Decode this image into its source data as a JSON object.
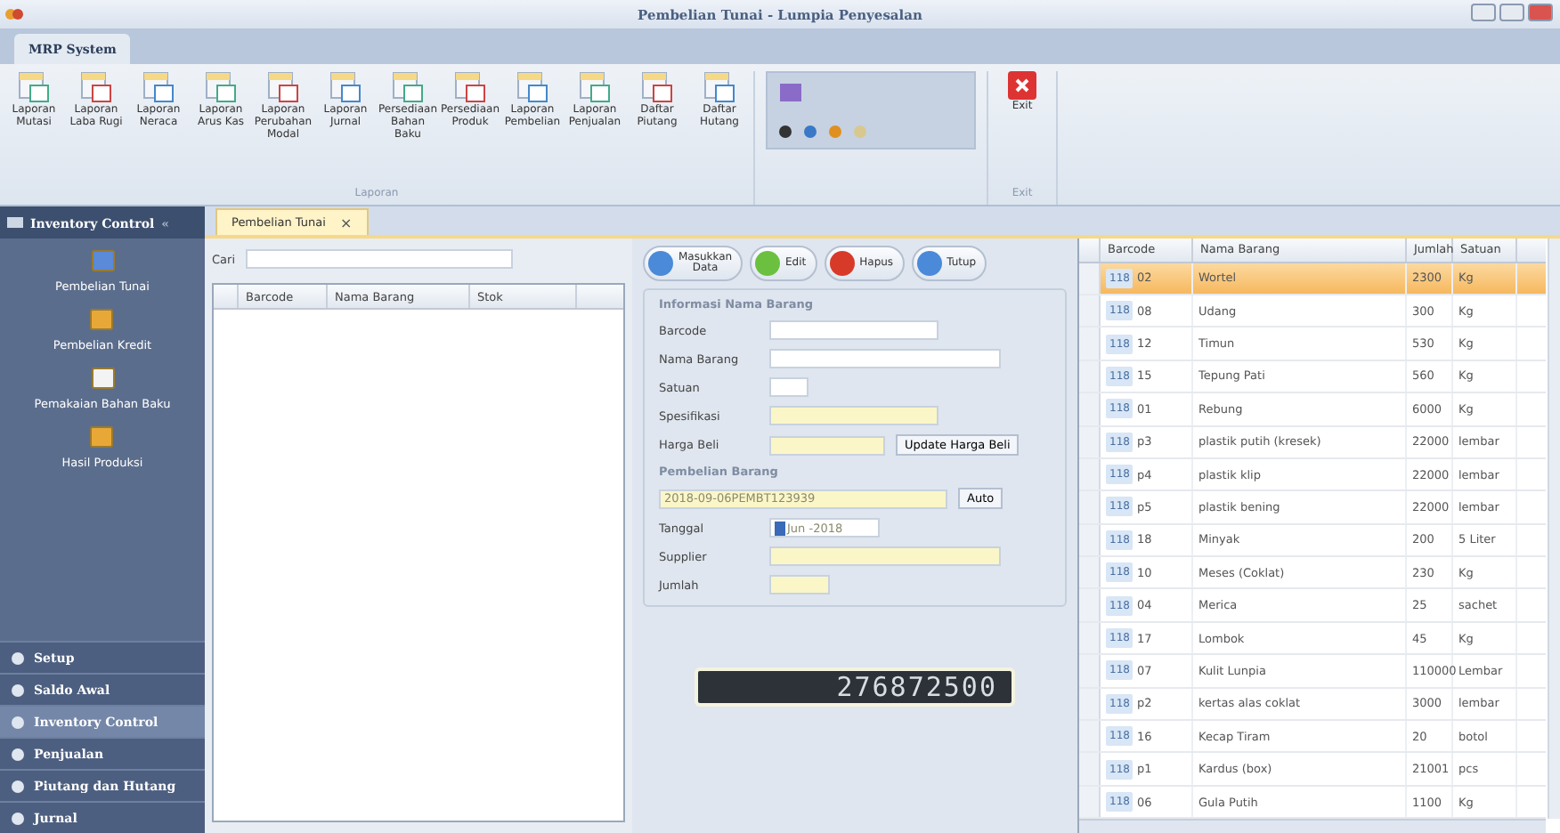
{
  "window": {
    "title": "Pembelian Tunai - Lumpia Penyesalan"
  },
  "ribbon": {
    "tabs": [
      {
        "label": "MRP System",
        "selected": true
      }
    ],
    "buttons": [
      {
        "label": "Laporan Mutasi"
      },
      {
        "label": "Laporan Laba Rugi"
      },
      {
        "label": "Laporan Neraca"
      },
      {
        "label": "Laporan Arus Kas"
      },
      {
        "label": "Laporan Perubahan Modal"
      },
      {
        "label": "Laporan Jurnal"
      },
      {
        "label": "Persediaan Bahan Baku"
      },
      {
        "label": "Persediaan Produk"
      },
      {
        "label": "Laporan Pembelian"
      },
      {
        "label": "Laporan Penjualan"
      },
      {
        "label": "Daftar Piutang"
      },
      {
        "label": "Daftar Hutang"
      }
    ],
    "group_label": "Laporan",
    "exit_label": "Exit",
    "exit_group_label": "Exit"
  },
  "sidebar": {
    "title": "Inventory Control",
    "collapse": "«",
    "items": [
      {
        "label": "Pembelian Tunai"
      },
      {
        "label": "Pembelian Kredit"
      },
      {
        "label": "Pemakaian Bahan Baku"
      },
      {
        "label": "Hasil Produksi"
      }
    ],
    "nav": [
      {
        "label": "Setup",
        "selected": false
      },
      {
        "label": "Saldo Awal",
        "selected": false
      },
      {
        "label": "Inventory Control",
        "selected": true
      },
      {
        "label": "Penjualan",
        "selected": false
      },
      {
        "label": "Piutang dan Hutang",
        "selected": false
      },
      {
        "label": "Jurnal",
        "selected": false
      }
    ]
  },
  "doc_tab": {
    "label": "Pembelian Tunai",
    "close": "×"
  },
  "search": {
    "label": "Cari"
  },
  "left_grid": {
    "columns": [
      "Barcode",
      "Nama Barang",
      "Stok"
    ]
  },
  "actions": [
    {
      "label": "Masukkan Data"
    },
    {
      "label": "Edit"
    },
    {
      "label": "Hapus"
    },
    {
      "label": "Tutup"
    }
  ],
  "info": {
    "title": "Informasi Nama Barang",
    "fields": [
      {
        "label": "Barcode"
      },
      {
        "label": "Nama Barang"
      },
      {
        "label": "Satuan"
      },
      {
        "label": "Spesifikasi"
      },
      {
        "label": "Harga Beli"
      }
    ],
    "update_button": "Update Harga Beli"
  },
  "purchase": {
    "title": "Pembelian Barang",
    "nota": "2018-09-06PEMBT123939",
    "auto_button": "Auto",
    "date_label": "Tanggal",
    "date": "Jun -2018",
    "supplier_label": "Supplier",
    "qty_label": "Jumlah"
  },
  "total": "276872500",
  "grid": {
    "columns": [
      "Barcode",
      "Nama Barang",
      "Jumlah",
      "Satuan"
    ],
    "rows": [
      {
        "prefix": "118",
        "barcode": "02",
        "name": "Wortel",
        "qty": "2300",
        "unit": "Kg",
        "selected": true
      },
      {
        "prefix": "118",
        "barcode": "08",
        "name": "Udang",
        "qty": "300",
        "unit": "Kg",
        "selected": false
      },
      {
        "prefix": "118",
        "barcode": "12",
        "name": "Timun",
        "qty": "530",
        "unit": "Kg",
        "selected": false
      },
      {
        "prefix": "118",
        "barcode": "15",
        "name": "Tepung Pati",
        "qty": "560",
        "unit": "Kg",
        "selected": false
      },
      {
        "prefix": "118",
        "barcode": "01",
        "name": "Rebung",
        "qty": "6000",
        "unit": "Kg",
        "selected": false
      },
      {
        "prefix": "118",
        "barcode": "p3",
        "name": "plastik putih (kresek)",
        "qty": "22000",
        "unit": "lembar",
        "selected": false
      },
      {
        "prefix": "118",
        "barcode": "p4",
        "name": "plastik klip",
        "qty": "22000",
        "unit": "lembar",
        "selected": false
      },
      {
        "prefix": "118",
        "barcode": "p5",
        "name": "plastik bening",
        "qty": "22000",
        "unit": "lembar",
        "selected": false
      },
      {
        "prefix": "118",
        "barcode": "18",
        "name": "Minyak",
        "qty": "200",
        "unit": "5 Liter",
        "selected": false
      },
      {
        "prefix": "118",
        "barcode": "10",
        "name": "Meses (Coklat)",
        "qty": "230",
        "unit": "Kg",
        "selected": false
      },
      {
        "prefix": "118",
        "barcode": "04",
        "name": "Merica",
        "qty": "25",
        "unit": "sachet",
        "selected": false
      },
      {
        "prefix": "118",
        "barcode": "17",
        "name": "Lombok",
        "qty": "45",
        "unit": "Kg",
        "selected": false
      },
      {
        "prefix": "118",
        "barcode": "07",
        "name": "Kulit Lunpia",
        "qty": "110000",
        "unit": "Lembar",
        "selected": false
      },
      {
        "prefix": "118",
        "barcode": "p2",
        "name": "kertas alas coklat",
        "qty": "3000",
        "unit": "lembar",
        "selected": false
      },
      {
        "prefix": "118",
        "barcode": "16",
        "name": "Kecap Tiram",
        "qty": "20",
        "unit": "botol",
        "selected": false
      },
      {
        "prefix": "118",
        "barcode": "p1",
        "name": "Kardus (box)",
        "qty": "21001",
        "unit": "pcs",
        "selected": false
      },
      {
        "prefix": "118",
        "barcode": "06",
        "name": "Gula Putih",
        "qty": "1100",
        "unit": "Kg",
        "selected": false
      }
    ]
  }
}
